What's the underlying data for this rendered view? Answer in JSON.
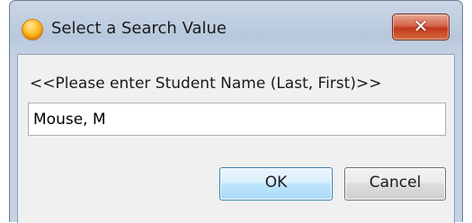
{
  "window": {
    "title": "Select a Search Value",
    "close_label": "✕"
  },
  "form": {
    "prompt": "<<Please enter Student Name (Last, First)>>",
    "input_value": "Mouse, M"
  },
  "buttons": {
    "ok_label": "OK",
    "cancel_label": "Cancel"
  },
  "icons": {
    "app_icon": "orange-circle-icon",
    "close_icon": "close-icon"
  },
  "colors": {
    "titlebar": "#c9d6e6",
    "close_button": "#c1391d",
    "ok_button_border": "#3c7fb1",
    "app_icon": "#ffbf2a"
  }
}
